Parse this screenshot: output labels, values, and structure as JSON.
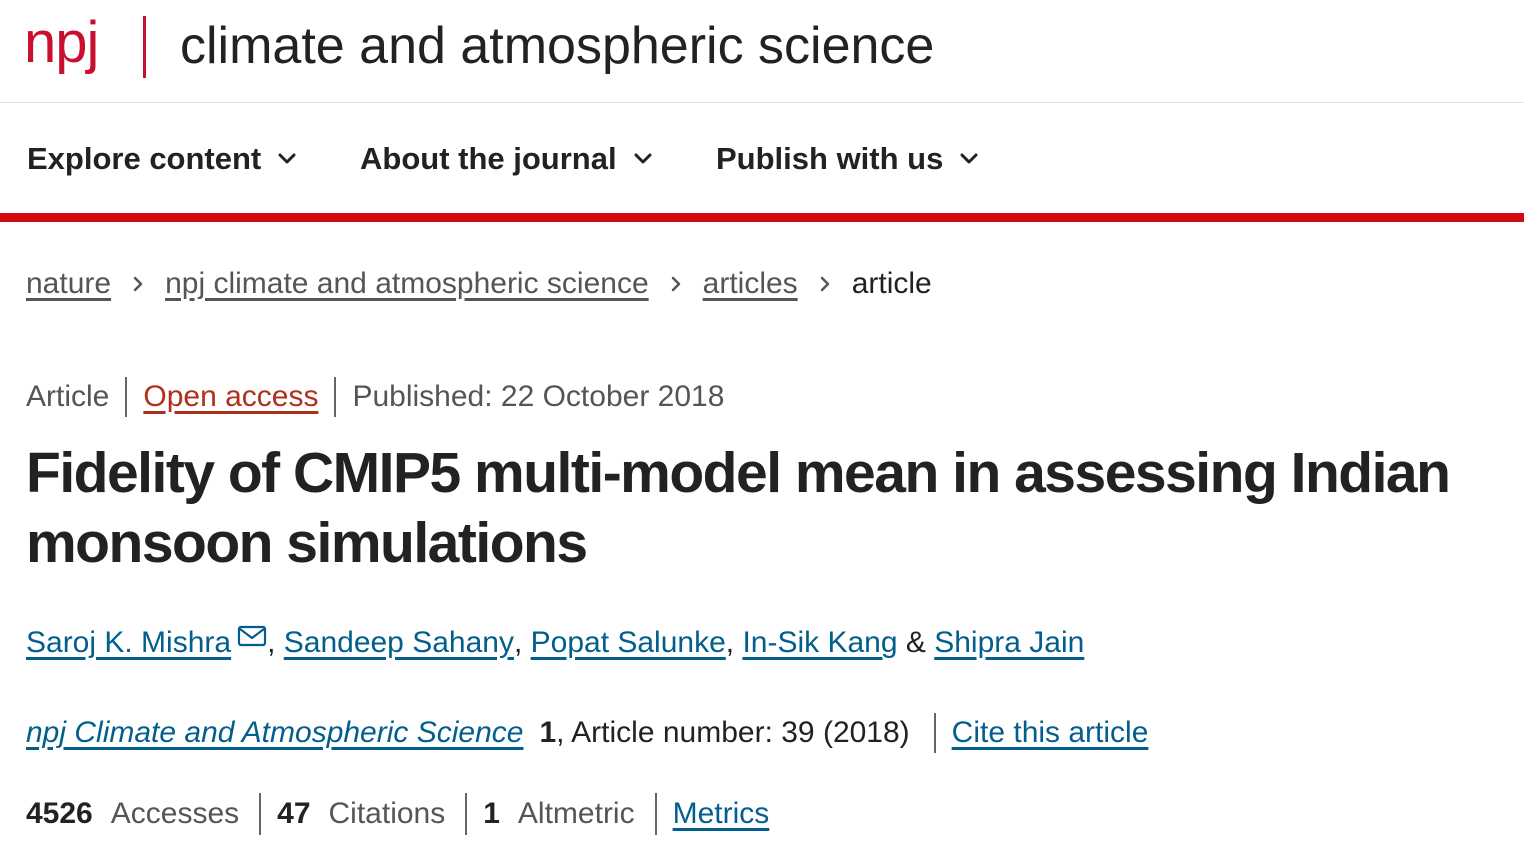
{
  "header": {
    "logo_text": "npj",
    "journal_title": "climate and atmospheric science"
  },
  "nav": {
    "items": [
      {
        "label": "Explore content",
        "icon": "chevron-down-icon"
      },
      {
        "label": "About the journal",
        "icon": "chevron-down-icon"
      },
      {
        "label": "Publish with us",
        "icon": "chevron-down-icon"
      }
    ]
  },
  "breadcrumb": {
    "items": [
      "nature",
      "npj climate and atmospheric science",
      "articles"
    ],
    "current": "article"
  },
  "article": {
    "type": "Article",
    "access": "Open access",
    "published": "Published: 22 October 2018",
    "title": "Fidelity of CMIP5 multi-model mean in assessing Indian monsoon simulations",
    "authors": [
      "Saroj K. Mishra",
      "Sandeep Sahany",
      "Popat Salunke",
      "In-Sik Kang",
      "Shipra Jain"
    ],
    "author_sep": ", ",
    "author_last_sep": " & ",
    "journal": "npj Climate and Atmospheric Science",
    "volume": "1",
    "article_number": ", Article number: 39 (2018)",
    "cite_label": "Cite this article"
  },
  "metrics": {
    "accesses_count": "4526",
    "accesses_label": "Accesses",
    "citations_count": "47",
    "citations_label": "Citations",
    "altmetric_count": "1",
    "altmetric_label": "Altmetric",
    "metrics_link": "Metrics"
  },
  "colors": {
    "brand_red": "#c8102e",
    "rule_red": "#d20a11",
    "link_blue": "#025e8d",
    "open_access": "#b1301c"
  }
}
